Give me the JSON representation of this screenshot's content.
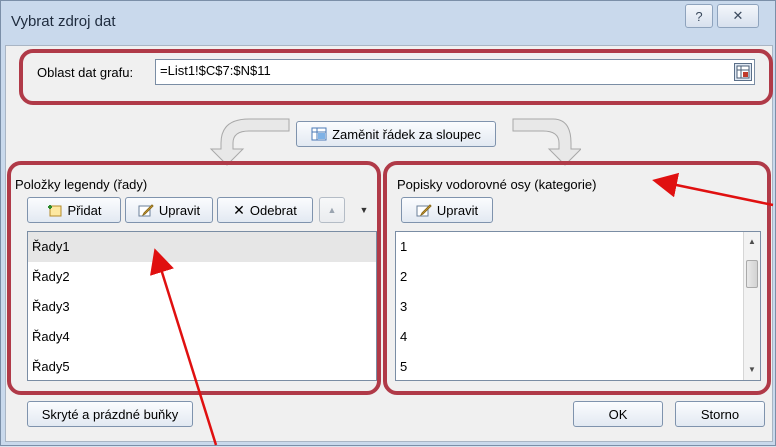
{
  "window": {
    "title": "Vybrat zdroj dat",
    "help_glyph": "?",
    "close_glyph": "✕"
  },
  "data_range": {
    "label": "Oblast dat grafu:",
    "value": "=List1!$C$7:$N$11"
  },
  "switch_button": {
    "label": "Zaměnit řádek za sloupec"
  },
  "legend": {
    "header": "Položky legendy (řady)",
    "add_label": "Přidat",
    "edit_label": "Upravit",
    "remove_label": "Odebrat",
    "items": [
      "Řady1",
      "Řady2",
      "Řady3",
      "Řady4",
      "Řady5"
    ]
  },
  "axis": {
    "header": "Popisky vodorovné osy (kategorie)",
    "edit_label": "Upravit",
    "items": [
      "1",
      "2",
      "3",
      "4",
      "5"
    ]
  },
  "footer": {
    "hidden_cells_label": "Skryté a prázdné buňky",
    "ok_label": "OK",
    "cancel_label": "Storno"
  },
  "colors": {
    "annotation": "#b03a48",
    "arrow": "#e01010"
  }
}
